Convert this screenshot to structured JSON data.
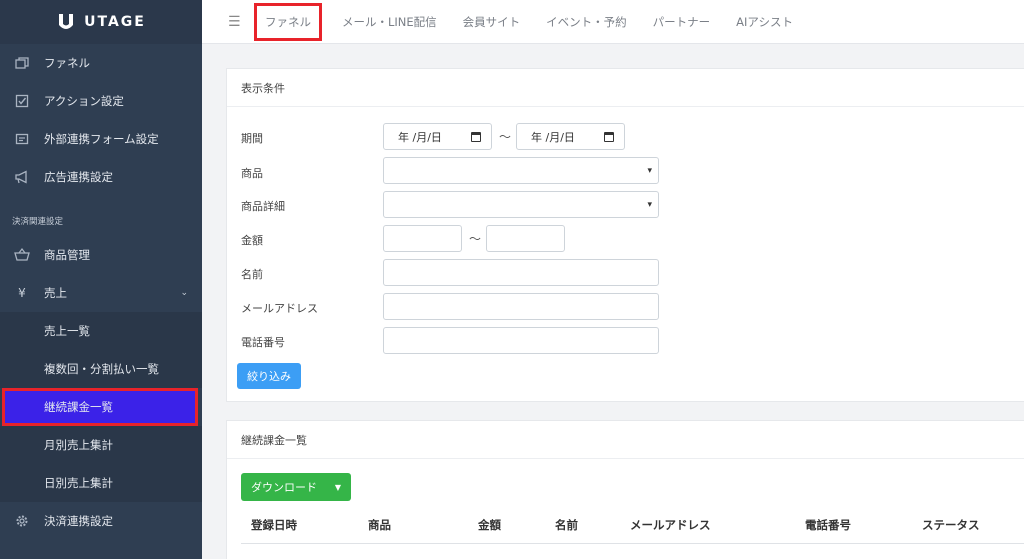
{
  "brand": {
    "name": "UTAGE"
  },
  "sidebar": {
    "items": [
      {
        "label": "ファネル",
        "icon": "funnel-icon"
      },
      {
        "label": "アクション設定",
        "icon": "checkbox-icon"
      },
      {
        "label": "外部連携フォーム設定",
        "icon": "form-icon"
      },
      {
        "label": "広告連携設定",
        "icon": "megaphone-icon"
      }
    ],
    "section_label": "決済関連設定",
    "payment_items": [
      {
        "label": "商品管理",
        "icon": "basket-icon"
      },
      {
        "label": "売上",
        "icon": "yen-icon",
        "expanded": true
      }
    ],
    "sales_sub": [
      {
        "label": "売上一覧"
      },
      {
        "label": "複数回・分割払い一覧"
      },
      {
        "label": "継続課金一覧",
        "active": true
      },
      {
        "label": "月別売上集計"
      },
      {
        "label": "日別売上集計"
      }
    ],
    "bottom_item": {
      "label": "決済連携設定",
      "icon": "gear-icon"
    }
  },
  "topbar": {
    "tabs": [
      {
        "label": "ファネル",
        "active": true
      },
      {
        "label": "メール・LINE配信"
      },
      {
        "label": "会員サイト"
      },
      {
        "label": "イベント・予約"
      },
      {
        "label": "パートナー"
      },
      {
        "label": "AIアシスト"
      }
    ]
  },
  "filter": {
    "title": "表示条件",
    "period_label": "期間",
    "date_placeholder": "年 /月/日",
    "tilde": "〜",
    "product_label": "商品",
    "product_detail_label": "商品詳細",
    "amount_label": "金額",
    "name_label": "名前",
    "email_label": "メールアドレス",
    "phone_label": "電話番号",
    "submit_label": "絞り込み"
  },
  "list": {
    "title": "継続課金一覧",
    "download_label": "ダウンロード",
    "columns": [
      "登録日時",
      "商品",
      "金額",
      "名前",
      "メールアドレス",
      "電話番号",
      "ステータス"
    ]
  },
  "colors": {
    "sidebar_bg": "#2f3e52",
    "active_sub": "#3b22e8",
    "highlight": "#e8232a",
    "primary": "#3c9ef5",
    "success": "#35b548"
  }
}
